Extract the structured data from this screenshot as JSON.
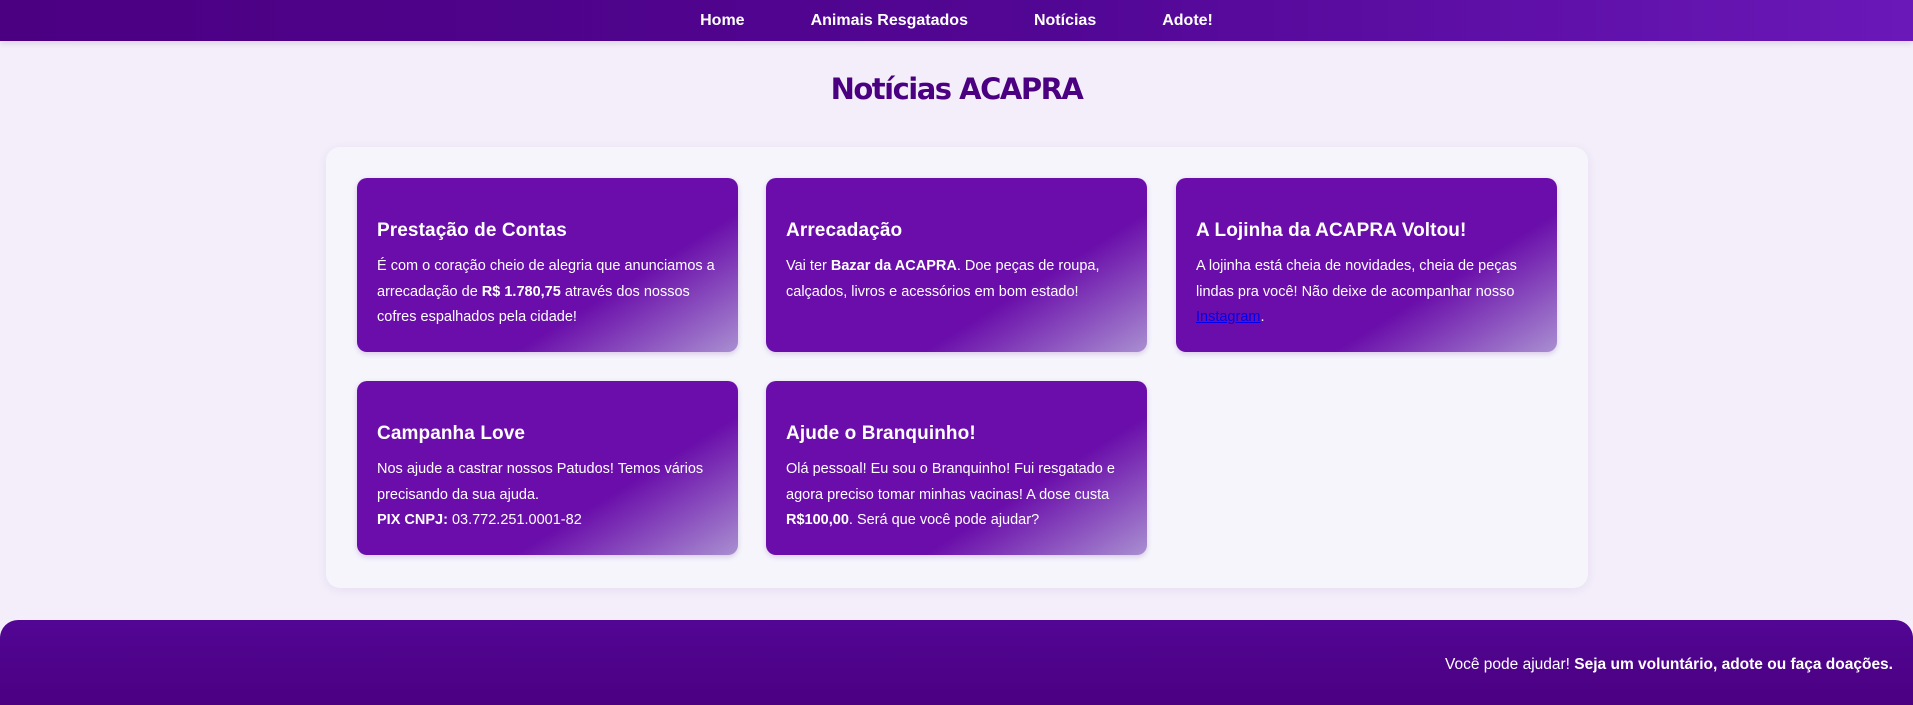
{
  "nav": {
    "items": [
      "Home",
      "Animais Resgatados",
      "Notícias",
      "Adote!"
    ]
  },
  "page": {
    "title": "Notícias ACAPRA"
  },
  "cards": [
    {
      "title": "Prestação de Contas",
      "text_1": "É com o coração cheio de alegria que anunciamos a arrecadação de ",
      "bold_1": "R$ 1.780,75",
      "text_2": " através dos nossos cofres espalhados pela cidade!"
    },
    {
      "title": "Arrecadação",
      "text_1": "Vai ter ",
      "bold_1": "Bazar da ACAPRA",
      "text_2": ". Doe peças de roupa, calçados, livros e acessórios em bom estado!"
    },
    {
      "title": "A Lojinha da ACAPRA Voltou!",
      "text_1": "A lojinha está cheia de novidades, cheia de peças lindas pra você! Não deixe de acompanhar nosso ",
      "link": "Instagram",
      "text_2": "."
    },
    {
      "title": "Campanha Love",
      "text_1": "Nos ajude a castrar nossos Patudos! Temos vários precisando da sua ajuda.",
      "bold_1": "PIX CNPJ:",
      "text_2": " 03.772.251.0001-82"
    },
    {
      "title": "Ajude o Branquinho!",
      "text_1": "Olá pessoal! Eu sou o Branquinho! Fui resgatado e agora preciso tomar minhas vacinas! A dose custa ",
      "bold_1": "R$100,00",
      "text_2": ". Será que você pode ajudar?"
    }
  ],
  "footer": {
    "text": "Você pode ajudar! ",
    "bold": "Seja um voluntário, adote ou faça doações."
  },
  "colors": {
    "primary": "#4b0082",
    "card": "#6a0daa",
    "background": "#f3eefa",
    "link": "#0000ee"
  }
}
